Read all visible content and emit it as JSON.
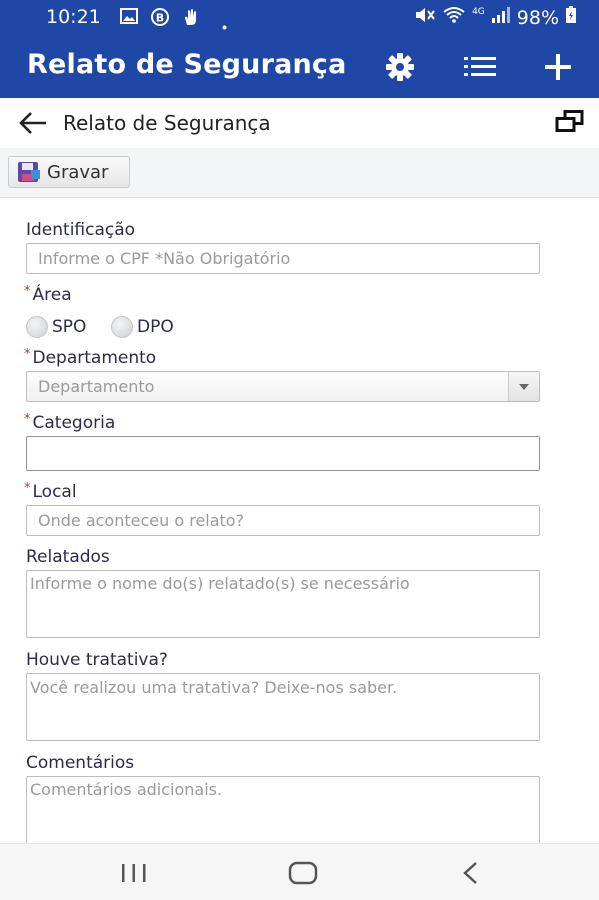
{
  "status_bar": {
    "time": "10:21",
    "battery": "98%",
    "network": "4G"
  },
  "app_bar": {
    "title": "Relato de Segurança",
    "icons": [
      "gear-icon",
      "list-icon",
      "plus-icon"
    ]
  },
  "page_header": {
    "title": "Relato de Segurança",
    "icons": [
      "back-arrow-icon",
      "window-restore-icon"
    ]
  },
  "toolbar": {
    "save_label": "Gravar",
    "save_icon": "floppy-disk-icon"
  },
  "form": {
    "identificacao": {
      "label": "Identificação",
      "placeholder": "Informe o CPF *Não Obrigatório"
    },
    "area": {
      "label": "Área",
      "required_marker": "*",
      "options": [
        "SPO",
        "DPO"
      ]
    },
    "departamento": {
      "label": "Departamento",
      "required_marker": "*",
      "placeholder": "Departamento"
    },
    "categoria": {
      "label": "Categoria",
      "required_marker": "*",
      "value": ""
    },
    "local": {
      "label": "Local",
      "required_marker": "*",
      "placeholder": "Onde aconteceu o relato?"
    },
    "relatados": {
      "label": "Relatados",
      "placeholder": "Informe o nome do(s) relatado(s) se necessário"
    },
    "tratativa": {
      "label": "Houve tratativa?",
      "placeholder": "Você realizou uma tratativa? Deixe-nos saber."
    },
    "comentarios": {
      "label": "Comentários",
      "placeholder": "Comentários adicionais."
    }
  },
  "colors": {
    "app_bar": "#1f47a6",
    "required": "#c0392b",
    "label_text": "#2c2c4a",
    "placeholder": "#9a9a9a"
  }
}
